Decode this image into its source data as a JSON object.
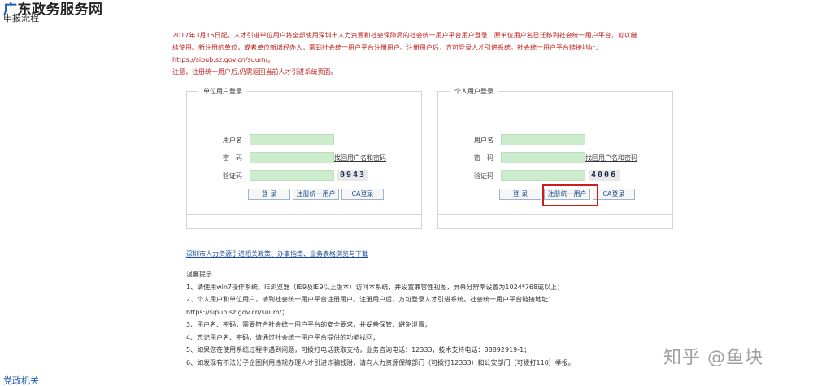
{
  "header": {
    "site_title_lead": "广",
    "site_title_rest": "东政务服务网",
    "process_label": "申报流程"
  },
  "notice": {
    "line1": "2017年3月15日起，人才引进单位用户将全部使用深圳市人力资源和社会保障局的社会统一用户平台用户登录，原单位用户名已迁移到社会统一用户平台，可以继",
    "line2": "续使用。新注册的单位，或者单位新增经办人，需到社会统一用户平台注册用户。注册用户后，方可登录人才引进系统。社会统一用户平台链接地址：",
    "url": "https://sipub.sz.gov.cn/suum/",
    "url_suffix": "。",
    "line4": "注意，注册统一用户后,仍需返回当前人才引进系统页面。"
  },
  "unit_login": {
    "title": "单位用户登录",
    "username_label": "用户名",
    "password_label": "密　码",
    "password_link": "找回用户名和密码",
    "captcha_label": "验证码",
    "captcha_value": "0943",
    "login_button": "登 录",
    "register_button": "注册统一用户",
    "ca_button": "CA登录"
  },
  "personal_login": {
    "title": "个人用户登录",
    "username_label": "用户名",
    "password_label": "密　码",
    "password_link": "找回用户名和密码",
    "captcha_label": "验证码",
    "captcha_value": "4006",
    "login_button": "登 录",
    "register_button": "注册统一用户",
    "ca_button": "CA登录"
  },
  "policy_link": "深圳市人力资源引进相关政策、办事指南、业务表格浏览与下载",
  "tips": {
    "title": "温馨提示",
    "items": [
      "1、请使用win7操作系统、IE浏览器（IE9及IE9以上版本）访问本系统，并设置兼容性视图，屏幕分辨率设置为1024*768或以上；",
      "2、个人用户和单位用户，请到社会统一用户平台注册用户。注册用户后，方可登录人才引进系统。社会统一用户平台链接地址：",
      "https://sipub.sz.gov.cn/suum/；",
      "3、用户名、密码，需要符合社会统一用户平台的安全要求，并妥善保管，避免泄露；",
      "4、忘记用户名、密码，请通过社会统一用户平台提供的功能找回；",
      "5、如果您在使用系统过程中遇到问题，可拨打电话获取支持，业务咨询电话：12333，技术支持电话：88892919-1；",
      "6、如发现有不法分子企图利用违规办理人才引进诈骗钱财，请向人力资源保障部门（可拨打12333）和公安部门（可拨打110）举报。"
    ]
  },
  "watermark": "知乎 @鱼块",
  "footer": {
    "link": "党政机关"
  },
  "colors": {
    "notice_red": "#c0201c",
    "input_green": "#cdeccd",
    "link_blue": "#1a4c9a",
    "highlight_red": "#d11a1a"
  }
}
